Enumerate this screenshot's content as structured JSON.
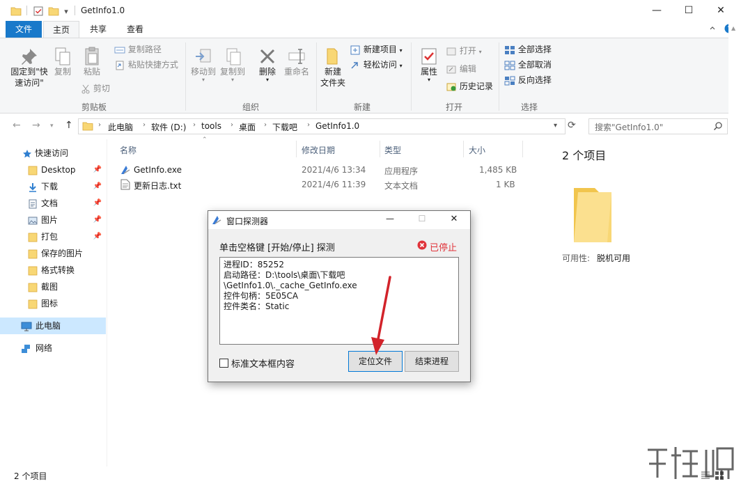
{
  "window": {
    "title": "GetInfo1.0",
    "quick_access_dropdown": "▾",
    "controls": {
      "minimize": "—",
      "maximize": "☐",
      "close": "✕"
    }
  },
  "ribbon_tabs": {
    "file": "文件",
    "home": "主页",
    "share": "共享",
    "view": "查看"
  },
  "ribbon": {
    "clipboard": {
      "label": "剪贴板",
      "pin_line1": "固定到\"快",
      "pin_line2": "速访问\"",
      "copy": "复制",
      "paste": "粘贴",
      "copy_path": "复制路径",
      "paste_shortcut": "粘贴快捷方式",
      "cut": "剪切"
    },
    "organize": {
      "label": "组织",
      "move_to": "移动到",
      "copy_to": "复制到",
      "delete": "删除",
      "rename": "重命名"
    },
    "new": {
      "label": "新建",
      "new_folder_line1": "新建",
      "new_folder_line2": "文件夹",
      "new_item": "新建项目",
      "easy_access": "轻松访问"
    },
    "open": {
      "label": "打开",
      "properties": "属性",
      "open": "打开",
      "edit": "编辑",
      "history": "历史记录"
    },
    "select": {
      "label": "选择",
      "select_all": "全部选择",
      "select_none": "全部取消",
      "invert": "反向选择"
    }
  },
  "address": {
    "breadcrumbs": [
      "此电脑",
      "软件 (D:)",
      "tools",
      "桌面",
      "下载吧",
      "GetInfo1.0"
    ],
    "search_placeholder": "搜索\"GetInfo1.0\""
  },
  "nav": {
    "quick_access": "快速访问",
    "items": [
      "Desktop",
      "下载",
      "文档",
      "图片",
      "打包",
      "保存的图片",
      "格式转换",
      "截图",
      "图标"
    ],
    "this_pc": "此电脑",
    "network": "网络"
  },
  "columns": {
    "name": "名称",
    "modified": "修改日期",
    "type": "类型",
    "size": "大小"
  },
  "files": [
    {
      "name": "GetInfo.exe",
      "modified": "2021/4/6 13:34",
      "type": "应用程序",
      "size": "1,485 KB"
    },
    {
      "name": "更新日志.txt",
      "modified": "2021/4/6 11:39",
      "type": "文本文档",
      "size": "1 KB"
    }
  ],
  "details": {
    "count": "2 个项目",
    "availability_label": "可用性:",
    "availability_value": "脱机可用"
  },
  "status": {
    "count": "2 个项目"
  },
  "dialog": {
    "title": "窗口探测器",
    "instruction": "单击空格键 [开始/停止] 探测",
    "status": "已停止",
    "info_lines": [
      "进程ID：85252",
      "启动路径：D:\\tools\\桌面\\下载吧",
      "\\GetInfo1.0\\._cache_GetInfo.exe",
      "控件句柄：5E05CA",
      "控件类名：Static"
    ],
    "checkbox_label": "标准文本框内容",
    "locate_button": "定位文件",
    "end_button": "结束进程",
    "controls": {
      "minimize": "—",
      "maximize": "☐",
      "close": "✕"
    }
  },
  "colors": {
    "accent": "#1979ca",
    "folder": "#f8d775",
    "stopped": "#e0333a",
    "arrow": "#d2232a"
  }
}
